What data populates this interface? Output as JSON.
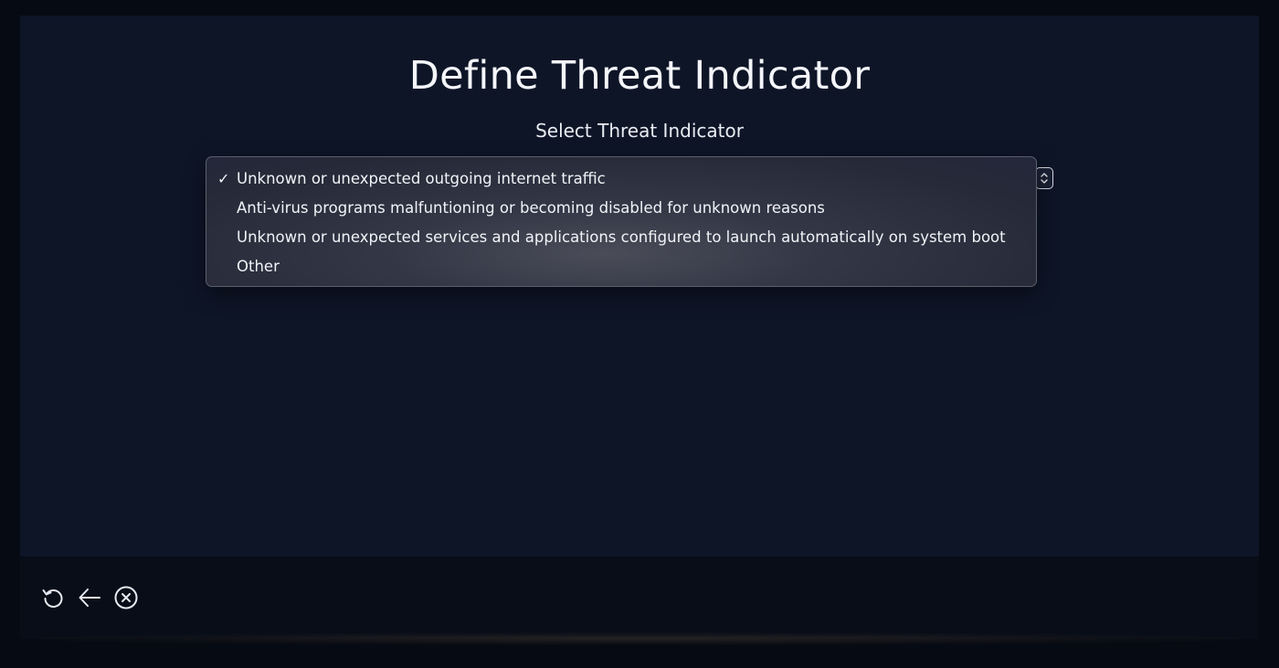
{
  "dialog": {
    "title": "Define Threat Indicator",
    "subtitle": "Select Threat Indicator"
  },
  "select": {
    "selected_value": "Unknown or unexpected outgoing internet traffic",
    "options": [
      {
        "label": "Unknown or unexpected outgoing internet traffic",
        "selected": true,
        "check": "✓"
      },
      {
        "label": "Anti-virus programs malfuntioning or becoming disabled for unknown reasons",
        "selected": false,
        "check": ""
      },
      {
        "label": "Unknown or unexpected services and applications configured to launch automatically on system boot",
        "selected": false,
        "check": ""
      },
      {
        "label": "Other",
        "selected": false,
        "check": ""
      }
    ]
  },
  "footer": {
    "icons": [
      "refresh-icon",
      "back-arrow-icon",
      "close-circle-icon"
    ]
  },
  "colors": {
    "dialog_bg": "#0e1527",
    "page_bg": "#060a13",
    "dropdown_bg": "#2b2e3c",
    "text": "#f1f3f7"
  }
}
